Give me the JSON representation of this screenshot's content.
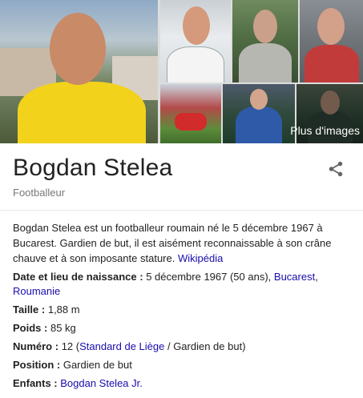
{
  "gallery": {
    "more_images_label": "Plus d'images"
  },
  "entity": {
    "name": "Bogdan Stelea",
    "subtitle": "Footballeur",
    "share_icon": "share-icon"
  },
  "description": {
    "text": "Bogdan Stelea est un footballeur roumain né le 5 décembre 1967 à Bucarest. Gardien de but, il est aisément reconnaissable à son crâne chauve et à son imposante stature.",
    "source_label": "Wikipédia"
  },
  "facts": {
    "birth": {
      "label": "Date et lieu de naissance",
      "value": "5 décembre 1967 (50 ans), ",
      "link1": "Bucarest",
      "separator": ", ",
      "link2": "Roumanie"
    },
    "height": {
      "label": "Taille",
      "value": "1,88 m"
    },
    "weight": {
      "label": "Poids",
      "value": "85 kg"
    },
    "number": {
      "label": "Numéro",
      "value_prefix": "12 (",
      "link": "Standard de Liège",
      "value_suffix": " / Gardien de but)"
    },
    "position": {
      "label": "Position",
      "value": "Gardien de but"
    },
    "children": {
      "label": "Enfants",
      "link": "Bogdan Stelea Jr."
    }
  },
  "colors": {
    "link": "#1a0dab",
    "text": "#222222",
    "muted": "#777777",
    "jacket_yellow": "#f2d21b"
  }
}
